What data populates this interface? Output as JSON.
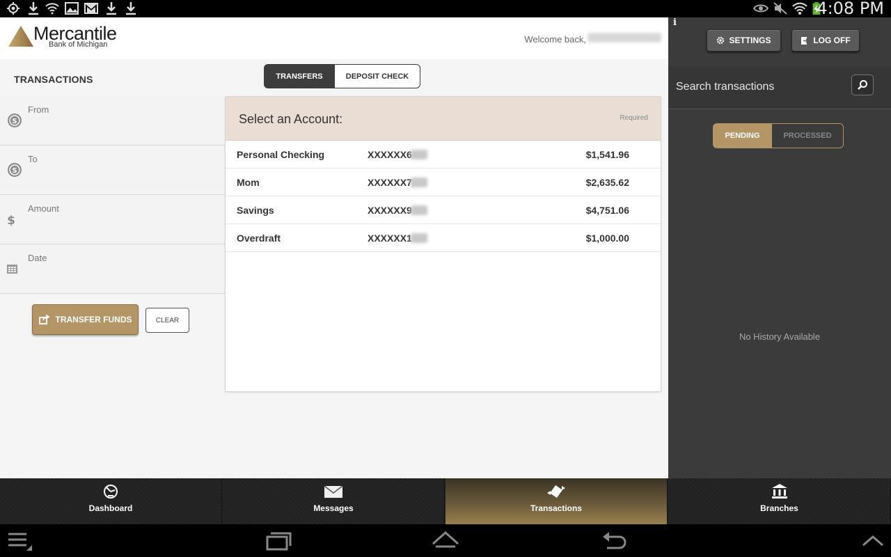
{
  "status_bar": {
    "time": "4:08 PM"
  },
  "header": {
    "brand_name": "Mercantile",
    "brand_sub": "Bank of Michigan",
    "welcome": "Welcome back,"
  },
  "page": {
    "title": "TRANSACTIONS"
  },
  "mode_tabs": {
    "transfers": "TRANSFERS",
    "deposit": "DEPOSIT CHECK",
    "active": "TRANSFERS"
  },
  "form": {
    "from_label": "From",
    "to_label": "To",
    "amount_label": "Amount",
    "date_label": "Date",
    "transfer_button": "TRANSFER FUNDS",
    "clear_button": "CLEAR"
  },
  "accounts_panel": {
    "title": "Select an Account:",
    "required": "Required",
    "accounts": [
      {
        "name": "Personal Checking",
        "number": "XXXXXX6",
        "balance": "$1,541.96"
      },
      {
        "name": "Mom",
        "number": "XXXXXX7",
        "balance": "$2,635.62"
      },
      {
        "name": "Savings",
        "number": "XXXXXX9",
        "balance": "$4,751.06"
      },
      {
        "name": "Overdraft",
        "number": "XXXXXX1",
        "balance": "$1,000.00"
      }
    ]
  },
  "right_panel": {
    "info": "i",
    "settings_button": "SETTINGS",
    "logoff_button": "LOG OFF",
    "search_placeholder": "Search transactions",
    "pending": "PENDING",
    "processed": "PROCESSED",
    "active_filter": "PENDING",
    "empty_text": "No History Available"
  },
  "tabs": [
    {
      "label": "Dashboard",
      "icon": "dashboard-icon"
    },
    {
      "label": "Messages",
      "icon": "envelope-icon"
    },
    {
      "label": "Transactions",
      "icon": "transfer-icon",
      "active": true
    },
    {
      "label": "Branches",
      "icon": "bank-icon"
    }
  ],
  "colors": {
    "accent": "#b49566",
    "dark_panel": "#3b3b3b",
    "account_header": "#e9ddd4"
  }
}
